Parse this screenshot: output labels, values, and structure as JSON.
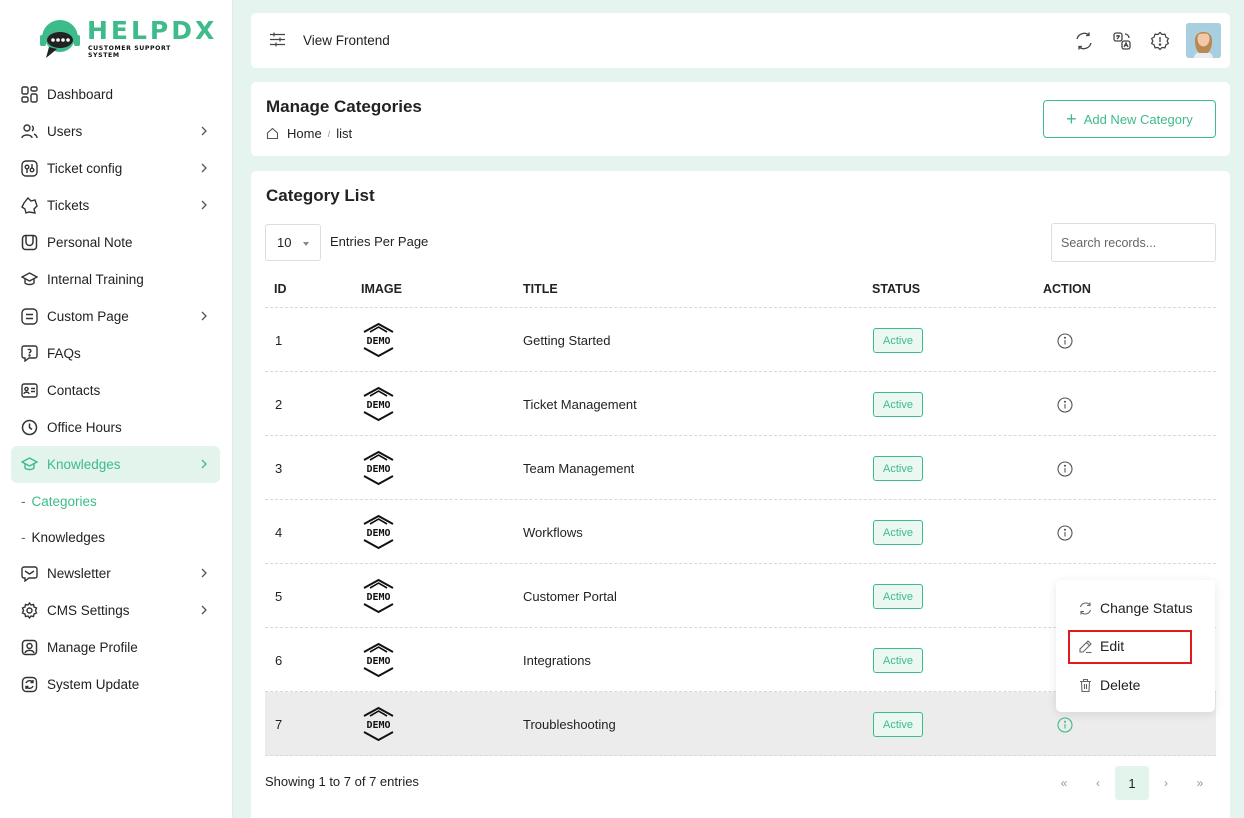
{
  "brand": {
    "name": "HELPDX",
    "tagline": "CUSTOMER SUPPORT SYSTEM",
    "accent": "#3dbb8a"
  },
  "sidebar": {
    "items": [
      {
        "label": "Dashboard",
        "icon": "dashboard-icon",
        "chevron": false
      },
      {
        "label": "Users",
        "icon": "users-icon",
        "chevron": true
      },
      {
        "label": "Ticket config",
        "icon": "ticket-config-icon",
        "chevron": true
      },
      {
        "label": "Tickets",
        "icon": "tickets-icon",
        "chevron": true
      },
      {
        "label": "Personal Note",
        "icon": "note-icon",
        "chevron": false
      },
      {
        "label": "Internal Training",
        "icon": "training-icon",
        "chevron": false
      },
      {
        "label": "Custom Page",
        "icon": "page-icon",
        "chevron": true
      },
      {
        "label": "FAQs",
        "icon": "faq-icon",
        "chevron": false
      },
      {
        "label": "Contacts",
        "icon": "contacts-icon",
        "chevron": false
      },
      {
        "label": "Office Hours",
        "icon": "clock-icon",
        "chevron": false
      },
      {
        "label": "Knowledges",
        "icon": "knowledge-icon",
        "chevron": true,
        "active": true
      },
      {
        "label": "Newsletter",
        "icon": "newsletter-icon",
        "chevron": true
      },
      {
        "label": "CMS Settings",
        "icon": "gear-icon",
        "chevron": true
      },
      {
        "label": "Manage Profile",
        "icon": "profile-icon",
        "chevron": false
      },
      {
        "label": "System Update",
        "icon": "update-icon",
        "chevron": false
      }
    ],
    "subitems": [
      {
        "label": "Categories",
        "active": true
      },
      {
        "label": "Knowledges",
        "active": false
      }
    ]
  },
  "topbar": {
    "view_frontend": "View Frontend"
  },
  "header": {
    "title": "Manage Categories",
    "breadcrumb_home": "Home",
    "breadcrumb_current": "list",
    "add_button": "Add New Category"
  },
  "list": {
    "title": "Category List",
    "per_page": "10",
    "per_page_label": "Entries Per Page",
    "search_placeholder": "Search records...",
    "columns": [
      "ID",
      "IMAGE",
      "TITLE",
      "STATUS",
      "ACTION"
    ],
    "image_text": "DEMO",
    "rows": [
      {
        "id": "1",
        "title": "Getting Started",
        "status": "Active"
      },
      {
        "id": "2",
        "title": "Ticket Management",
        "status": "Active"
      },
      {
        "id": "3",
        "title": "Team Management",
        "status": "Active"
      },
      {
        "id": "4",
        "title": "Workflows",
        "status": "Active"
      },
      {
        "id": "5",
        "title": "Customer Portal",
        "status": "Active"
      },
      {
        "id": "6",
        "title": "Integrations",
        "status": "Active"
      },
      {
        "id": "7",
        "title": "Troubleshooting",
        "status": "Active"
      }
    ],
    "showing": "Showing 1 to 7 of 7 entries",
    "pagination": {
      "first": "«",
      "prev": "‹",
      "current": "1",
      "next": "›",
      "last": "»"
    }
  },
  "action_menu": {
    "change_status": "Change Status",
    "edit": "Edit",
    "delete": "Delete"
  }
}
